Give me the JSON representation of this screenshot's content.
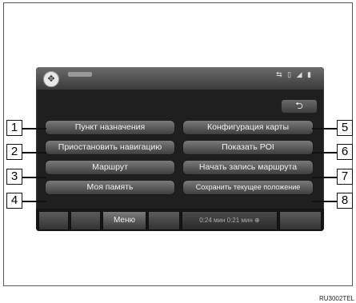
{
  "screen": {
    "status_icons": "⇆ ▯ ◢ ▮",
    "back_icon": "⮌"
  },
  "menu": {
    "items": [
      {
        "number": "1",
        "label": "Пункт назначения"
      },
      {
        "number": "2",
        "label": "Приостановить навигацию"
      },
      {
        "number": "3",
        "label": "Маршрут"
      },
      {
        "number": "4",
        "label": "Моя память"
      },
      {
        "number": "5",
        "label": "Конфигурация карты"
      },
      {
        "number": "6",
        "label": "Показать POI"
      },
      {
        "number": "7",
        "label": "Начать запись маршрута"
      },
      {
        "number": "8",
        "label": "Сохранить текущее положение"
      }
    ]
  },
  "bottombar": {
    "menu_label": "Меню",
    "info_text": "0:24 мин   0:21 мин ⊕"
  },
  "caption": "RU3002TEL"
}
